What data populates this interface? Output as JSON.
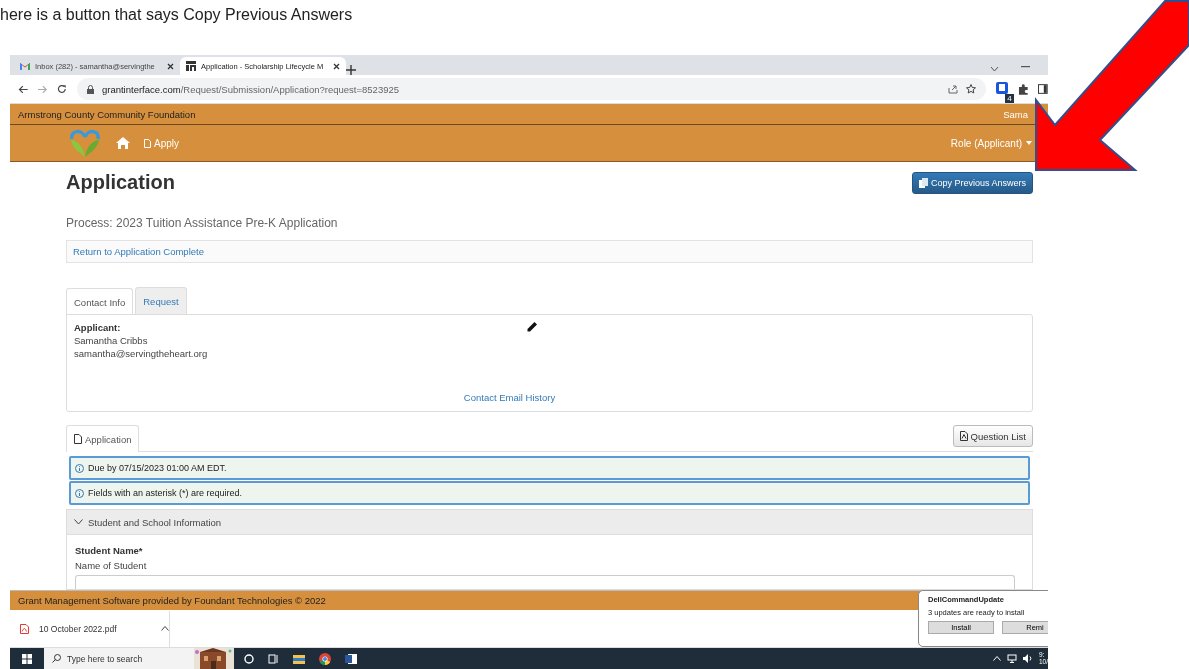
{
  "caption": "here is a button that says Copy Previous Answers",
  "browser": {
    "tabs": [
      {
        "title": "Inbox (282) - samantha@servingthe",
        "kind": "mail",
        "selected": false
      },
      {
        "title": "Application - Scholarship Lifecycle M",
        "kind": "site",
        "selected": true
      }
    ],
    "url_host": "grantinterface.com",
    "url_path": "/Request/Submission/Application?request=8523925",
    "extension_badge": "4"
  },
  "org_bar": {
    "name": "Armstrong County Community Foundation",
    "user": "Sama"
  },
  "nav": {
    "apply": "Apply",
    "role": "Role (Applicant)"
  },
  "page": {
    "title": "Application",
    "copy_button": "Copy Previous Answers",
    "process": "Process: 2023 Tuition Assistance Pre-K Application",
    "return_link": "Return to Application Complete",
    "contact_tabs": [
      {
        "label": "Contact Info",
        "selected": true
      },
      {
        "label": "Request",
        "selected": false
      }
    ],
    "contact": {
      "heading": "Applicant:",
      "name": "Samantha Cribbs",
      "email": "samantha@servingtheheart.org",
      "history_link": "Contact Email History"
    },
    "form_tabs": [
      {
        "label": "Application",
        "selected": true
      }
    ],
    "question_list": "Question List",
    "alerts": [
      "Due by 07/15/2023 01:00 AM EDT.",
      "Fields with an asterisk (*) are required."
    ],
    "section": {
      "title": "Student and School Information",
      "expanded": true,
      "fields": [
        {
          "label": "Student Name*",
          "hint": "Name of Student"
        }
      ]
    }
  },
  "footer": "Grant Management Software provided by Foundant Technologies © 2022",
  "download": {
    "file": "10 October 2022.pdf"
  },
  "taskbar": {
    "search_placeholder": "Type here to search",
    "clock_time": "9:",
    "clock_date": "10/"
  },
  "notification": {
    "title": "DellCommandUpdate",
    "message": "3 updates are ready to install",
    "buttons": [
      "Install",
      "Remi"
    ]
  }
}
